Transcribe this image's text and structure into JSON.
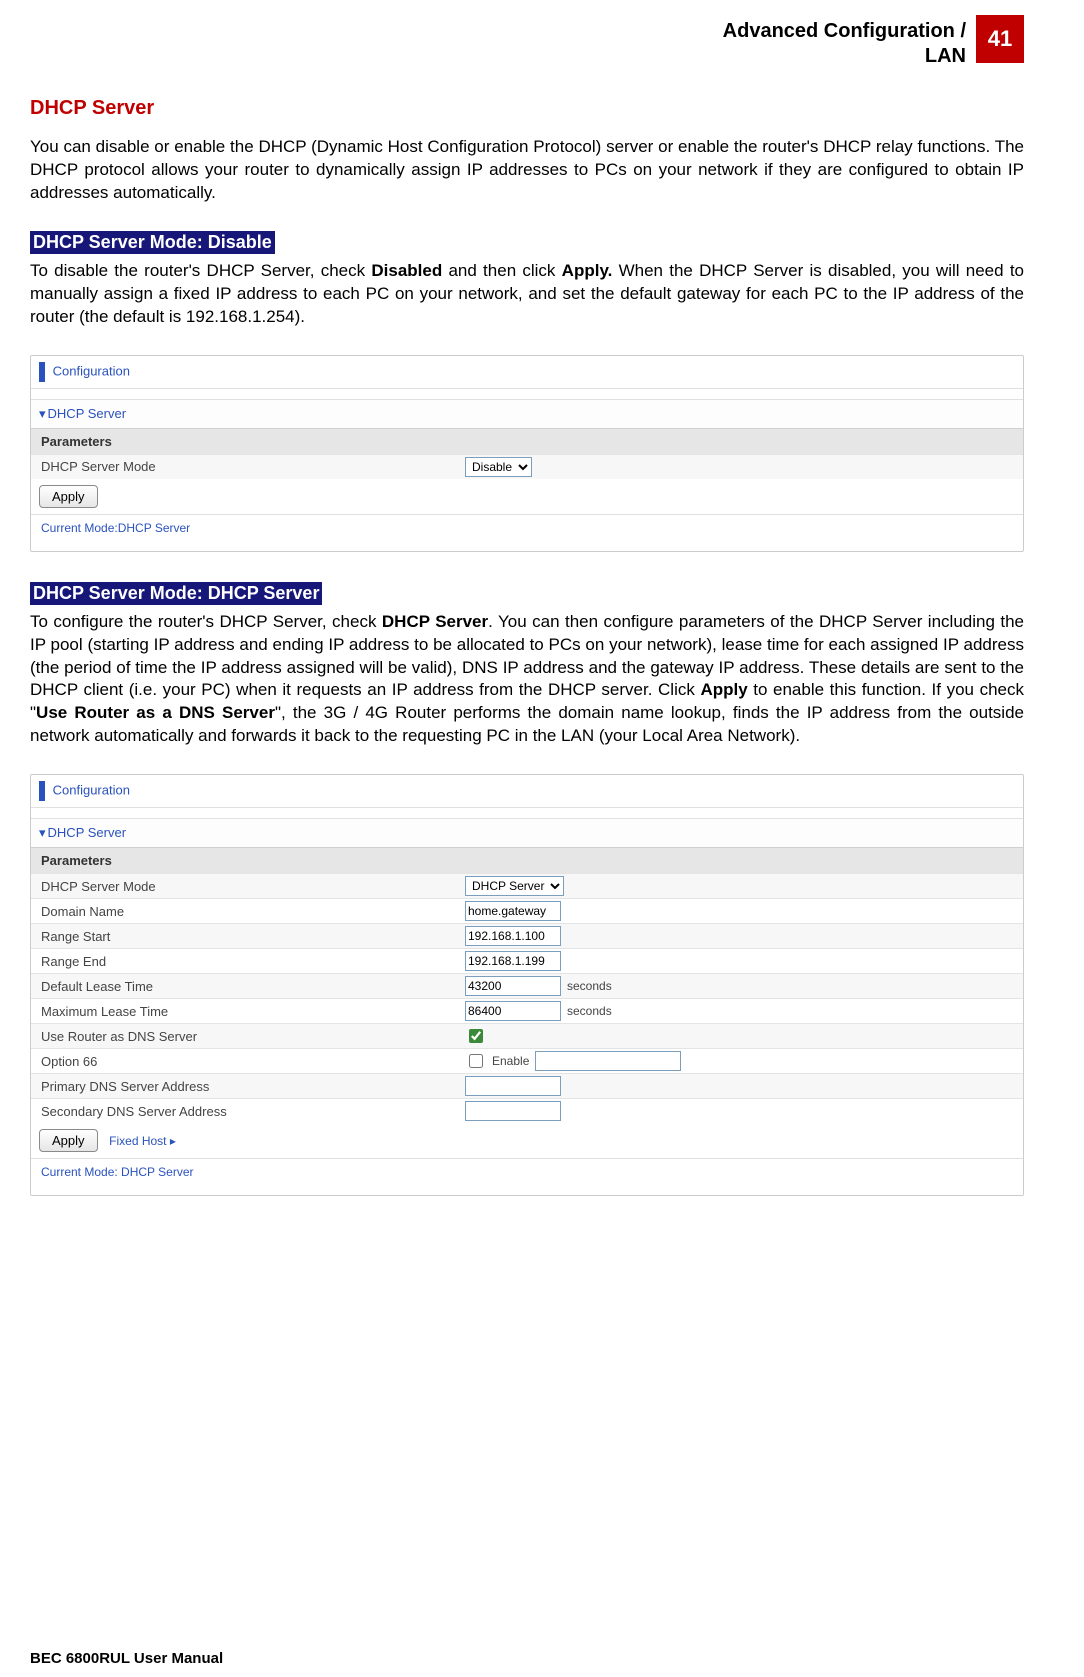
{
  "header": {
    "breadcrumb_line1": "Advanced Configuration /",
    "breadcrumb_line2": "LAN",
    "page_number": "41"
  },
  "section_title": "DHCP Server",
  "intro_text": "You can disable or enable the DHCP (Dynamic Host Configuration Protocol) server or enable the router's DHCP relay functions. The DHCP protocol allows your router to dynamically assign IP addresses to PCs on your network if they are configured to obtain IP addresses automatically.",
  "mode_disable": {
    "heading": "DHCP Server Mode: Disable",
    "text_before_bold1": "To disable the router's DHCP Server, check ",
    "bold1": "Disabled",
    "text_mid": " and then click ",
    "bold2": "Apply.",
    "text_after": " When the DHCP Server is disabled, you will need to manually assign a fixed IP address to each PC on your network, and set the default gateway for each PC to the IP address of the router (the default is 192.168.1.254)."
  },
  "screenshot1": {
    "config_label": "Configuration",
    "section": "DHCP Server",
    "params_label": "Parameters",
    "mode_label": "DHCP Server Mode",
    "mode_value": "Disable",
    "apply": "Apply",
    "current_mode": "Current Mode:DHCP Server"
  },
  "mode_server": {
    "heading": "DHCP Server Mode: DHCP Server",
    "text_before_bold1": "To configure the router's DHCP Server, check ",
    "bold1": "DHCP Server",
    "text_after_bold1": ". You can then configure parameters of the DHCP Server including the IP pool (starting IP address and ending IP address to be allocated to PCs on your network), lease time for each assigned IP address (the period of time the IP address assigned will be valid), DNS IP address and the gateway IP address. These details are sent to the DHCP client (i.e. your PC) when it requests an IP address from the DHCP server. Click ",
    "bold2": "Apply",
    "text_after_bold2": " to enable this function. If you check \"",
    "bold3": "Use Router as a DNS Server",
    "text_after_bold3": "\", the 3G / 4G Router performs the domain name lookup, finds the IP address from the outside network automatically and forwards it back to the requesting PC in the LAN (your Local Area Network)."
  },
  "screenshot2": {
    "config_label": "Configuration",
    "section": "DHCP Server",
    "params_label": "Parameters",
    "rows": {
      "mode": {
        "label": "DHCP Server Mode",
        "value": "DHCP Server"
      },
      "domain": {
        "label": "Domain Name",
        "value": "home.gateway"
      },
      "range_start": {
        "label": "Range Start",
        "value": "192.168.1.100"
      },
      "range_end": {
        "label": "Range End",
        "value": "192.168.1.199"
      },
      "def_lease": {
        "label": "Default Lease Time",
        "value": "43200",
        "unit": "seconds"
      },
      "max_lease": {
        "label": "Maximum Lease Time",
        "value": "86400",
        "unit": "seconds"
      },
      "use_router_dns": {
        "label": "Use Router as DNS Server"
      },
      "option66": {
        "label": "Option 66",
        "enable_label": "Enable"
      },
      "primary_dns": {
        "label": "Primary DNS Server Address",
        "value": ""
      },
      "secondary_dns": {
        "label": "Secondary DNS Server Address",
        "value": ""
      }
    },
    "apply": "Apply",
    "fixed_host": "Fixed Host",
    "current_mode": "Current Mode: DHCP Server"
  },
  "footer": "BEC 6800RUL User Manual"
}
